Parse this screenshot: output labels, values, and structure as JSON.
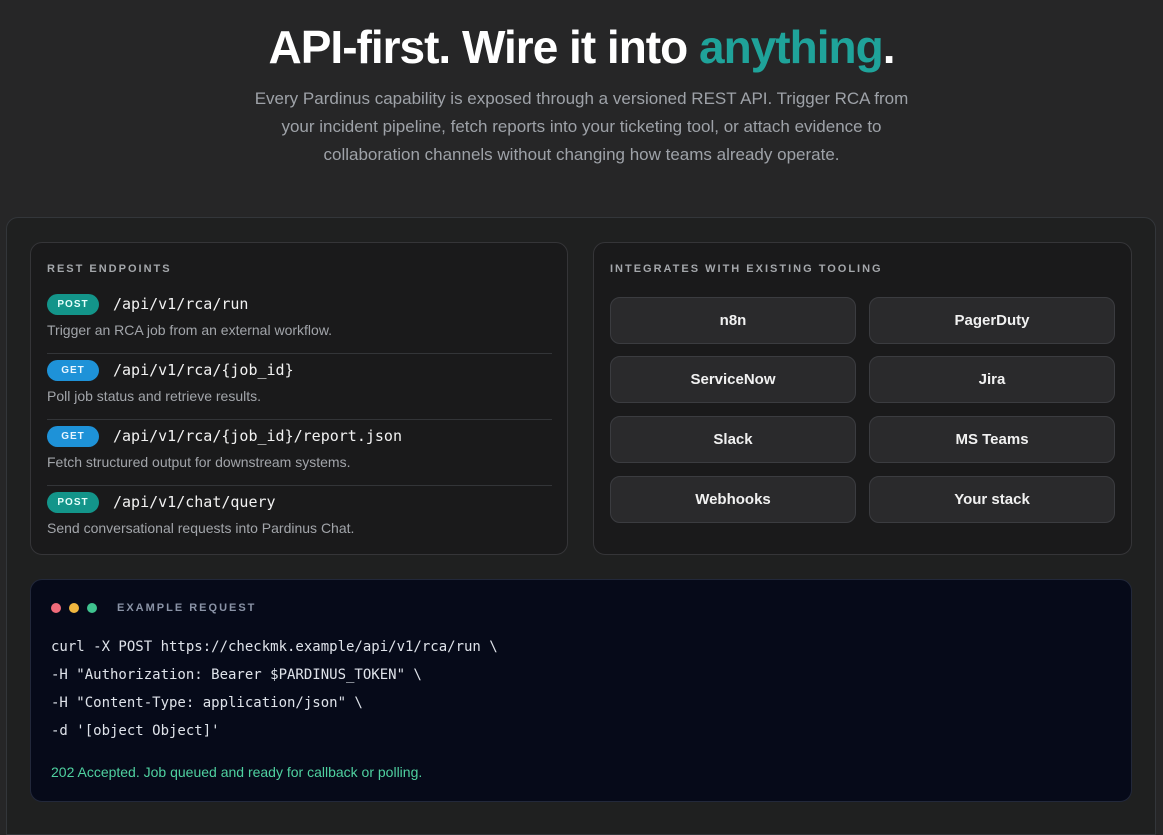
{
  "hero": {
    "title_main": "API-first. Wire it into ",
    "title_accent": "anything",
    "title_end": ".",
    "subtitle": "Every Pardinus capability is exposed through a versioned REST API. Trigger RCA from your incident pipeline, fetch reports into your ticketing tool, or attach evidence to collaboration channels without changing how teams already operate."
  },
  "endpoints": {
    "title": "REST ENDPOINTS",
    "items": [
      {
        "method": "POST",
        "path": "/api/v1/rca/run",
        "desc": "Trigger an RCA job from an external workflow."
      },
      {
        "method": "GET",
        "path": "/api/v1/rca/{job_id}",
        "desc": "Poll job status and retrieve results."
      },
      {
        "method": "GET",
        "path": "/api/v1/rca/{job_id}/report.json",
        "desc": "Fetch structured output for downstream systems."
      },
      {
        "method": "POST",
        "path": "/api/v1/chat/query",
        "desc": "Send conversational requests into Pardinus Chat."
      }
    ]
  },
  "integrations": {
    "title": "INTEGRATES WITH EXISTING TOOLING",
    "items": [
      "n8n",
      "PagerDuty",
      "ServiceNow",
      "Jira",
      "Slack",
      "MS Teams",
      "Webhooks",
      "Your stack"
    ]
  },
  "terminal": {
    "title": "EXAMPLE REQUEST",
    "lines": [
      "curl -X POST https://checkmk.example/api/v1/rca/run \\",
      "-H \"Authorization: Bearer $PARDINUS_TOKEN\" \\",
      "-H \"Content-Type: application/json\" \\",
      "-d '[object Object]'"
    ],
    "status": "202 Accepted. Job queued and ready for callback or polling."
  },
  "colors": {
    "accent": "#1fa39a",
    "post": "#13958a",
    "get": "#1e92d8",
    "success": "#4fd1a0",
    "dot_red": "#f06b7a",
    "dot_yellow": "#f1b73f",
    "dot_green": "#3fc38f"
  }
}
